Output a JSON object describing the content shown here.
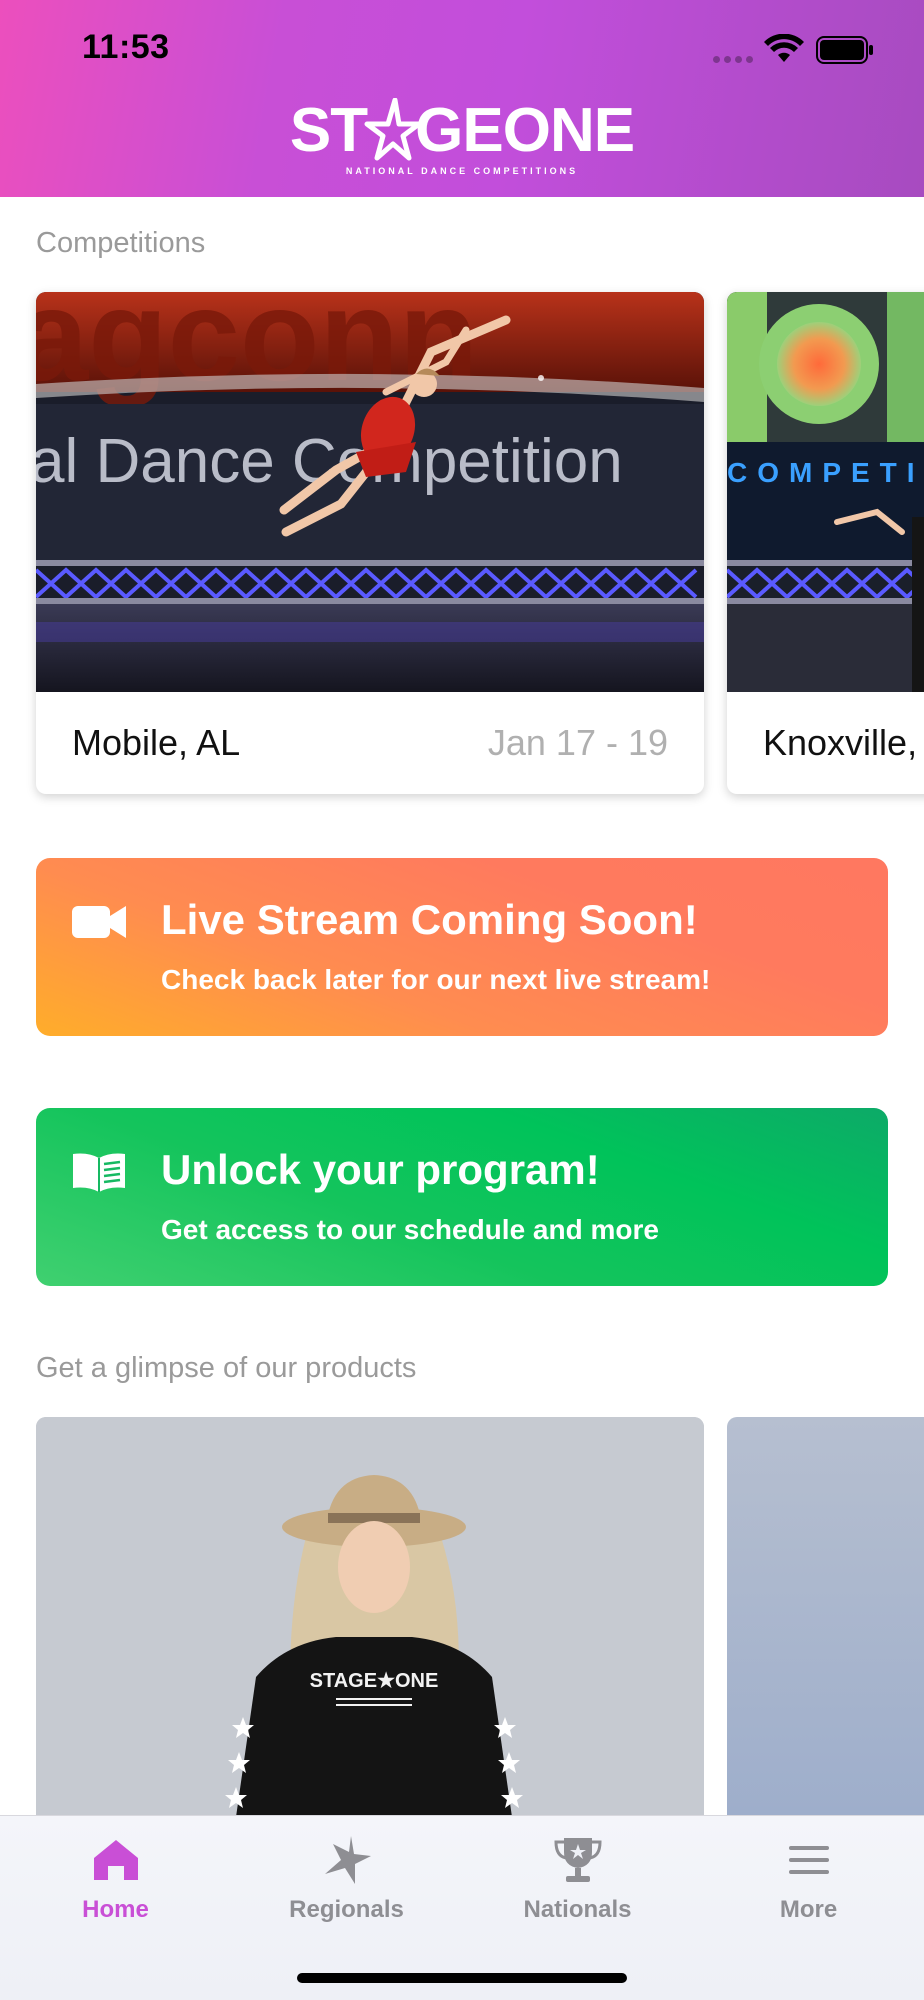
{
  "status_bar": {
    "time": "11:53"
  },
  "header": {
    "logo_left": "ST",
    "logo_right": "GEONE",
    "logo_subtitle": "NATIONAL DANCE COMPETITIONS"
  },
  "competitions": {
    "section_title": "Competitions",
    "items": [
      {
        "city": "Mobile, AL",
        "dates": "Jan 17 - 19",
        "backdrop_text": "al Dance Competition"
      },
      {
        "city": "Knoxville, TN",
        "dates": "",
        "backdrop_text": "COMPETI"
      }
    ]
  },
  "live_stream": {
    "title": "Live Stream Coming Soon!",
    "subtitle": "Check back later for our next live stream!",
    "icon": "video-camera-icon"
  },
  "program": {
    "title": "Unlock your program!",
    "subtitle": "Get access to our schedule and more",
    "icon": "open-book-icon"
  },
  "products": {
    "section_title": "Get a glimpse of our products",
    "shirt_text": "STAGE★ONE"
  },
  "tabs": [
    {
      "label": "Home",
      "icon": "home-icon",
      "active": true
    },
    {
      "label": "Regionals",
      "icon": "star-icon",
      "active": false
    },
    {
      "label": "Nationals",
      "icon": "trophy-icon",
      "active": false
    },
    {
      "label": "More",
      "icon": "menu-icon",
      "active": false
    }
  ],
  "colors": {
    "accent": "#c94fd6",
    "live_gradient": [
      "#ffad2a",
      "#ff7860"
    ],
    "program_gradient": [
      "#40d070",
      "#0daa68"
    ]
  }
}
